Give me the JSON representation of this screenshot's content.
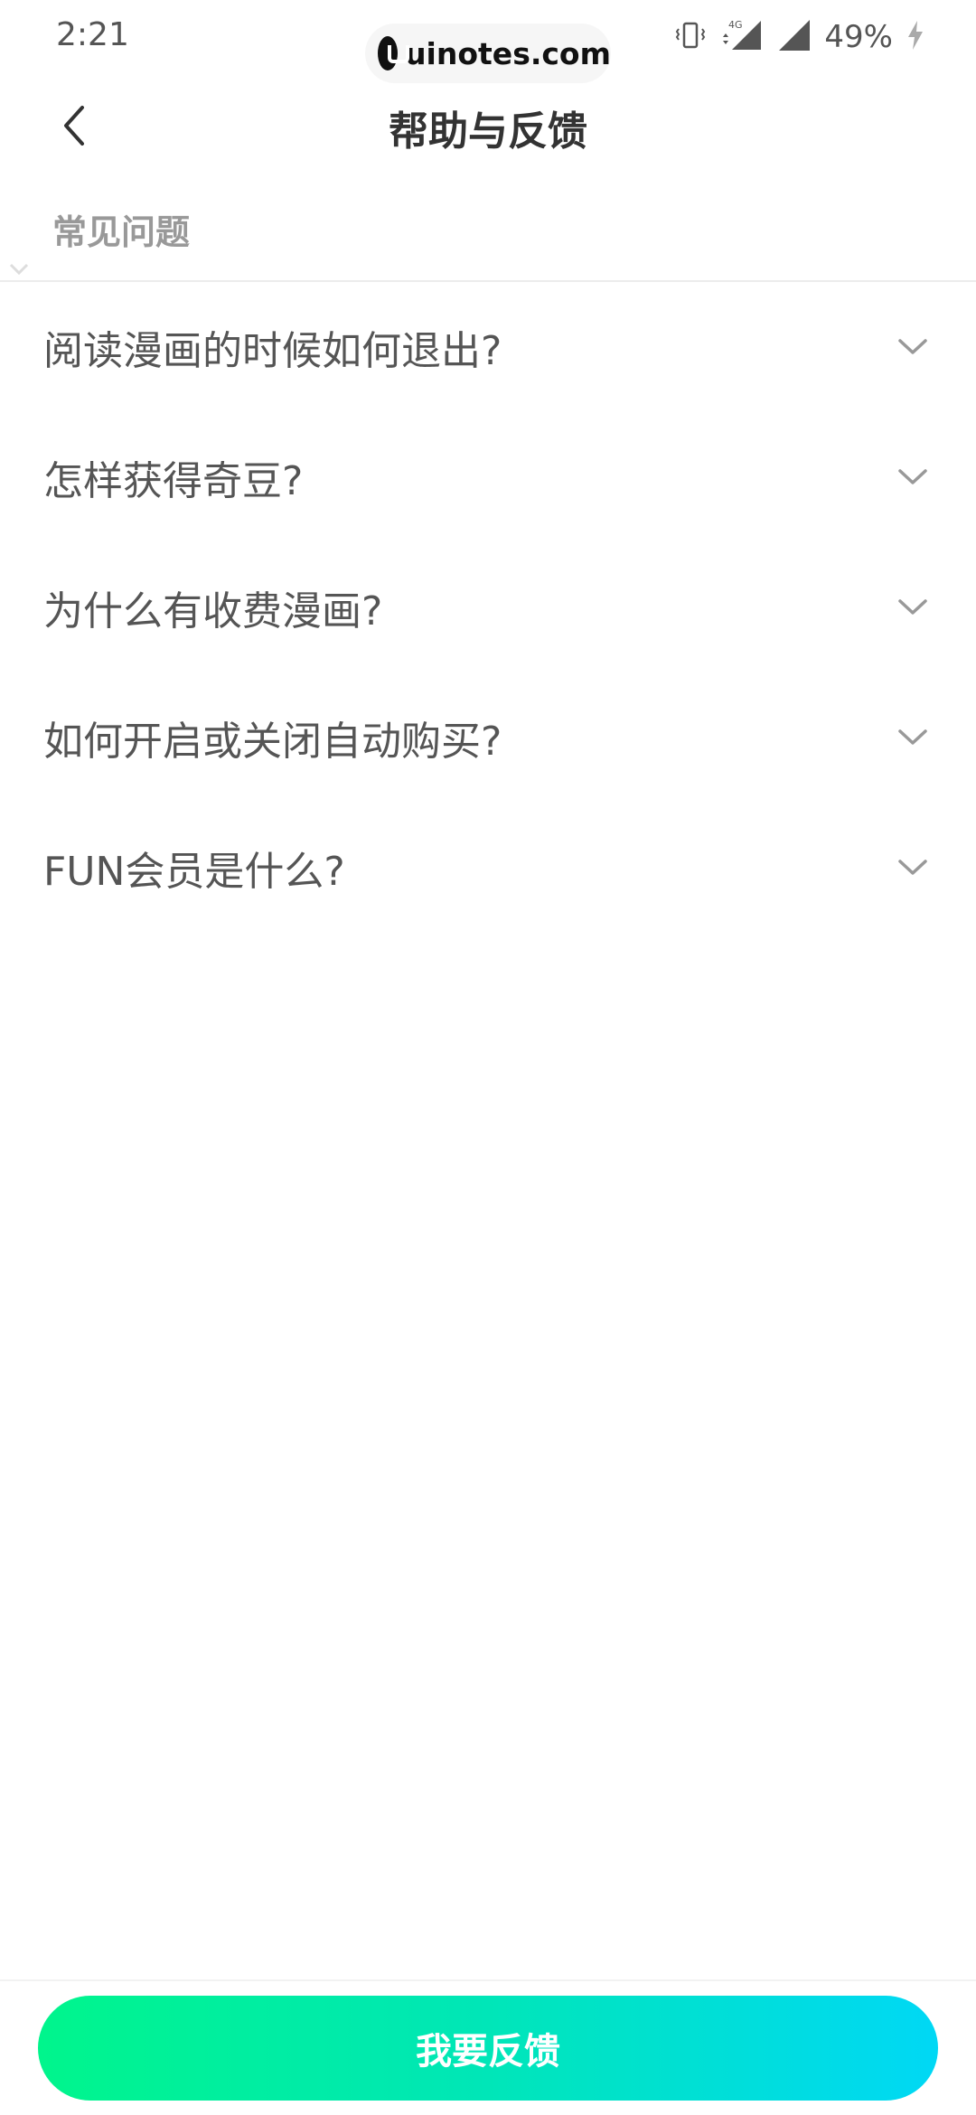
{
  "status_bar": {
    "time": "2:21",
    "battery": "49%",
    "network_label": "4G",
    "icons": [
      "vibrate-icon",
      "signal-4g-icon",
      "signal-icon",
      "charging-icon"
    ]
  },
  "watermark": {
    "text": "uinotes.com"
  },
  "header": {
    "title": "帮助与反馈",
    "back_icon": "back-arrow-icon"
  },
  "section": {
    "title": "常见问题"
  },
  "faq": [
    {
      "question": "阅读漫画的时候如何退出?"
    },
    {
      "question": "怎样获得奇豆?"
    },
    {
      "question": "为什么有收费漫画?"
    },
    {
      "question": "如何开启或关闭自动购买?"
    },
    {
      "question": "FUN会员是什么?"
    }
  ],
  "bottom": {
    "feedback_label": "我要反馈",
    "gradient": [
      "#00f58c",
      "#00d8f5"
    ]
  },
  "colors": {
    "accent_start": "#00f58c",
    "accent_end": "#00d8f5",
    "text_primary": "#333333",
    "text_secondary": "#999999"
  }
}
